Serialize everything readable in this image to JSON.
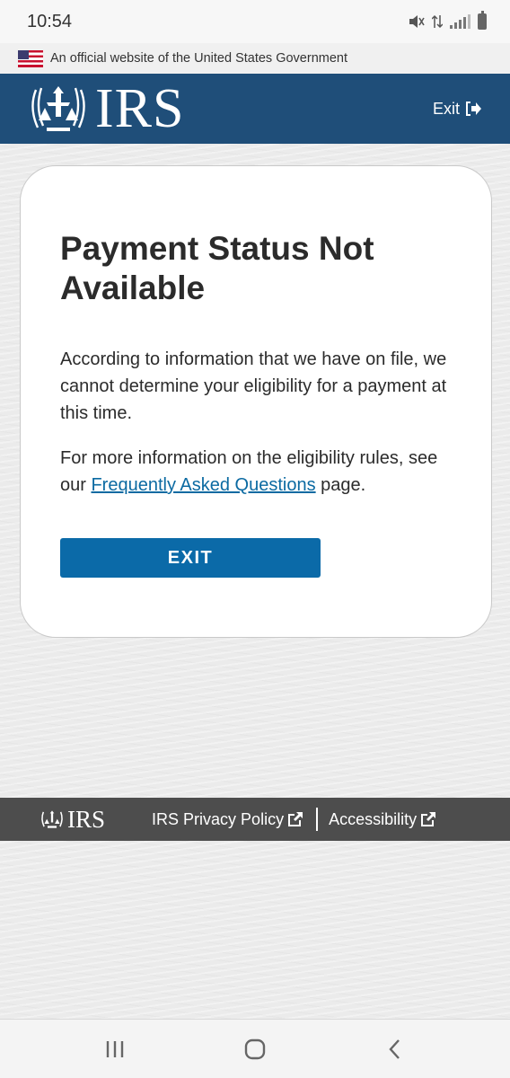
{
  "status_bar": {
    "time": "10:54"
  },
  "gov_banner": {
    "text": "An official website of the United States Government"
  },
  "header": {
    "logo_text": "IRS",
    "exit_label": "Exit"
  },
  "card": {
    "title": "Payment Status Not Available",
    "paragraph1": "According to information that we have on file, we cannot determine your eligibility for a payment at this time.",
    "paragraph2_before": "For more information on the eligibility rules, see our ",
    "faq_link": "Frequently Asked Questions",
    "paragraph2_after": " page.",
    "exit_button": "EXIT"
  },
  "footer": {
    "logo_text": "IRS",
    "privacy_link": "IRS Privacy Policy",
    "accessibility_link": "Accessibility"
  },
  "colors": {
    "header_bg": "#1f4e79",
    "button_bg": "#0b6aa8",
    "link": "#0b6aa2",
    "footer_bg": "#4d4d4d"
  },
  "icons": {
    "header_exit": "exit-arrow-icon",
    "external_link": "external-link-icon",
    "nav_recent": "recent-apps-icon",
    "nav_home": "home-icon",
    "nav_back": "back-icon"
  }
}
